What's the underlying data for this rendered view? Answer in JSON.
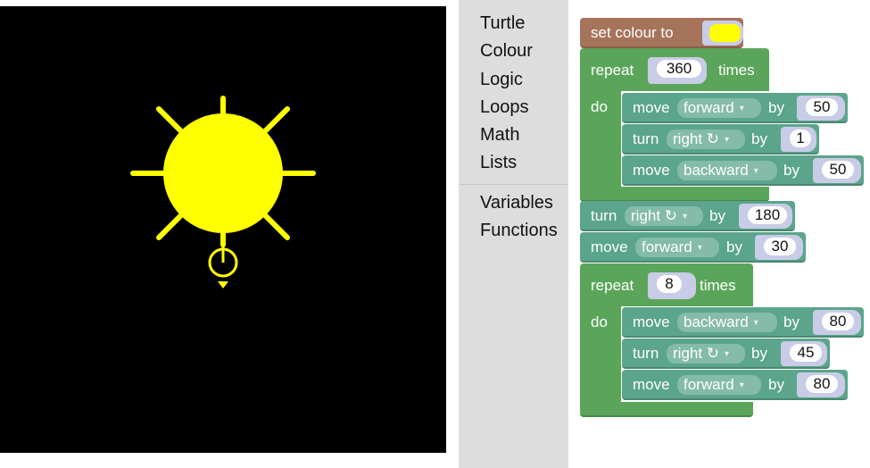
{
  "toolbox": {
    "categories": [
      "Turtle",
      "Colour",
      "Logic",
      "Loops",
      "Math",
      "Lists"
    ],
    "categories_2": [
      "Variables",
      "Functions"
    ]
  },
  "canvas": {
    "background": "#000000",
    "drawing_color": "#ffff00",
    "drawing": "sun"
  },
  "program": {
    "set_colour": {
      "label": "set colour to",
      "color": "#ffff00"
    },
    "repeat1": {
      "label": "repeat",
      "times": "360",
      "times_label": "times",
      "do_label": "do"
    },
    "move1": {
      "label": "move",
      "dir": "forward",
      "by": "by",
      "value": "50"
    },
    "turn1": {
      "label": "turn",
      "dir": "right ↻",
      "by": "by",
      "value": "1"
    },
    "move2": {
      "label": "move",
      "dir": "backward",
      "by": "by",
      "value": "50"
    },
    "turn2": {
      "label": "turn",
      "dir": "right ↻",
      "by": "by",
      "value": "180"
    },
    "move3": {
      "label": "move",
      "dir": "forward",
      "by": "by",
      "value": "30"
    },
    "repeat2": {
      "label": "repeat",
      "times": "8",
      "times_label": "times",
      "do_label": "do"
    },
    "move4": {
      "label": "move",
      "dir": "backward",
      "by": "by",
      "value": "80"
    },
    "turn3": {
      "label": "turn",
      "dir": "right ↻",
      "by": "by",
      "value": "45"
    },
    "move5": {
      "label": "move",
      "dir": "forward",
      "by": "by",
      "value": "80"
    }
  }
}
